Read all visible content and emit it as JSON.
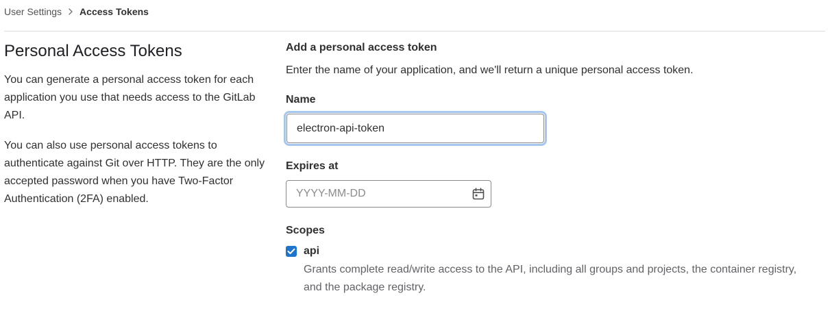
{
  "breadcrumb": {
    "parent": "User Settings",
    "current": "Access Tokens",
    "separator_icon": "chevron-right-icon"
  },
  "intro": {
    "title": "Personal Access Tokens",
    "paragraph1": "You can generate a personal access token for each application you use that needs access to the GitLab API.",
    "paragraph2": "You can also use personal access tokens to authenticate against Git over HTTP. They are the only accepted password when you have Two-Factor Authentication (2FA) enabled."
  },
  "form": {
    "title": "Add a personal access token",
    "description": "Enter the name of your application, and we'll return a unique personal access token.",
    "name_label": "Name",
    "name_value": "electron-api-token",
    "expires_label": "Expires at",
    "expires_placeholder": "YYYY-MM-DD",
    "expires_icon": "calendar-icon",
    "scopes_label": "Scopes",
    "scopes": [
      {
        "name": "api",
        "checked": true,
        "description": "Grants complete read/write access to the API, including all groups and projects, the container registry, and the package registry."
      }
    ]
  },
  "colors": {
    "accent": "#1f75cb",
    "focus_ring": "#a5c7ef",
    "border": "#89888d",
    "divider": "#dcdcde"
  }
}
